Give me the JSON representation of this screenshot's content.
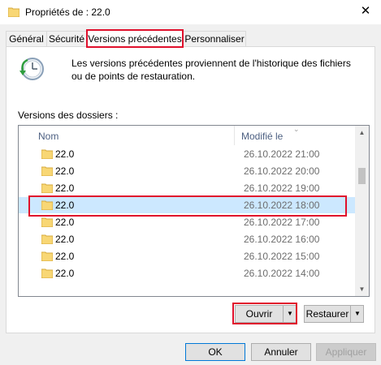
{
  "window": {
    "title": "Propriétés de : 22.0",
    "close_glyph": "✕"
  },
  "tabs": [
    {
      "label": "Général"
    },
    {
      "label": "Sécurité"
    },
    {
      "label": "Versions précédentes",
      "active": true
    },
    {
      "label": "Personnaliser"
    }
  ],
  "description": "Les versions précédentes proviennent de l'historique des fichiers ou de points de restauration.",
  "versions_label": "Versions des dossiers :",
  "columns": {
    "name": "Nom",
    "modified": "Modifié le"
  },
  "rows": [
    {
      "name": "22.0",
      "date": "26.10.2022 21:00"
    },
    {
      "name": "22.0",
      "date": "26.10.2022 20:00"
    },
    {
      "name": "22.0",
      "date": "26.10.2022 19:00"
    },
    {
      "name": "22.0",
      "date": "26.10.2022 18:00",
      "selected": true
    },
    {
      "name": "22.0",
      "date": "26.10.2022 17:00"
    },
    {
      "name": "22.0",
      "date": "26.10.2022 16:00"
    },
    {
      "name": "22.0",
      "date": "26.10.2022 15:00"
    },
    {
      "name": "22.0",
      "date": "26.10.2022 14:00"
    }
  ],
  "buttons": {
    "open": "Ouvrir",
    "restore": "Restaurer",
    "ok": "OK",
    "cancel": "Annuler",
    "apply": "Appliquer"
  },
  "colors": {
    "highlight": "#e0102c",
    "selection": "#cce8ff",
    "folder": "#f8d775"
  }
}
